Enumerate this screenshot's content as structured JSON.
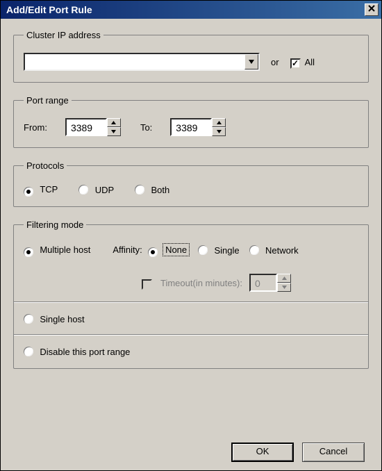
{
  "window": {
    "title": "Add/Edit Port Rule"
  },
  "cluster": {
    "legend": "Cluster IP address",
    "dropdown_value": "",
    "or_label": "or",
    "all_label": "All",
    "all_checked": true
  },
  "portrange": {
    "legend": "Port range",
    "from_label": "From:",
    "from_value": "3389",
    "to_label": "To:",
    "to_value": "3389"
  },
  "protocols": {
    "legend": "Protocols",
    "tcp": "TCP",
    "udp": "UDP",
    "both": "Both",
    "selected": "tcp"
  },
  "filtering": {
    "legend": "Filtering mode",
    "multiple_host": "Multiple host",
    "affinity_label": "Affinity:",
    "affinity": {
      "none": "None",
      "single": "Single",
      "network": "Network",
      "selected": "none"
    },
    "timeout_label": "Timeout(in minutes):",
    "timeout_value": "0",
    "timeout_enabled": false,
    "single_host": "Single host",
    "disable": "Disable this port range",
    "mode_selected": "multiple"
  },
  "buttons": {
    "ok": "OK",
    "cancel": "Cancel"
  }
}
